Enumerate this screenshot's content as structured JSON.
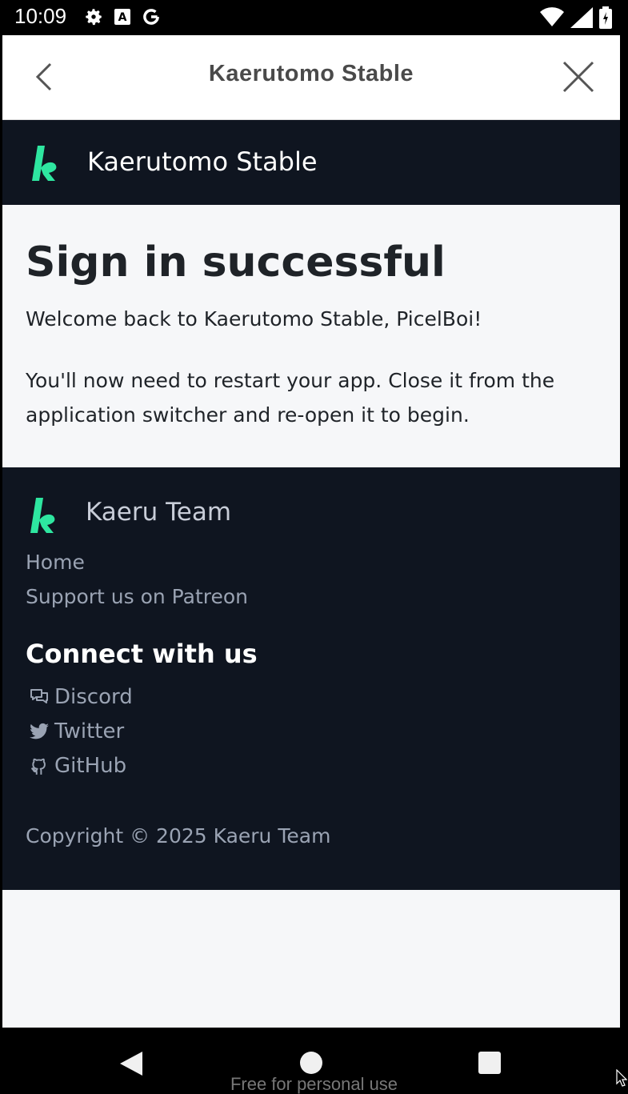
{
  "status_bar": {
    "time": "10:09",
    "left_icons": [
      "gear-icon",
      "a-icon",
      "google-icon"
    ],
    "right_icons": [
      "wifi-icon",
      "signal-icon",
      "battery-icon"
    ]
  },
  "custom_tab": {
    "title": "Kaerutomo Stable",
    "back_icon": "chevron-left-icon",
    "close_icon": "close-icon"
  },
  "site_header": {
    "name": "Kaerutomo Stable",
    "logo_color": "#2ee6a0"
  },
  "main": {
    "heading": "Sign in successful",
    "welcome": "Welcome back to Kaerutomo Stable, PicelBoi!",
    "instructions": "You'll now need to restart your app. Close it from the application switcher and re-open it to begin."
  },
  "footer": {
    "team_name": "Kaeru Team",
    "links": [
      {
        "label": "Home"
      },
      {
        "label": "Support us on Patreon"
      }
    ],
    "connect_heading": "Connect with us",
    "social": [
      {
        "label": "Discord",
        "icon": "chat-icon"
      },
      {
        "label": "Twitter",
        "icon": "twitter-icon"
      },
      {
        "label": "GitHub",
        "icon": "github-icon"
      }
    ],
    "copyright": "Copyright © 2025 Kaeru Team"
  },
  "nav_bar": {
    "watermark": "Free for personal use"
  },
  "colors": {
    "dark_bg": "#0f1520",
    "light_bg": "#f6f7f9",
    "accent": "#2ee6a0"
  }
}
